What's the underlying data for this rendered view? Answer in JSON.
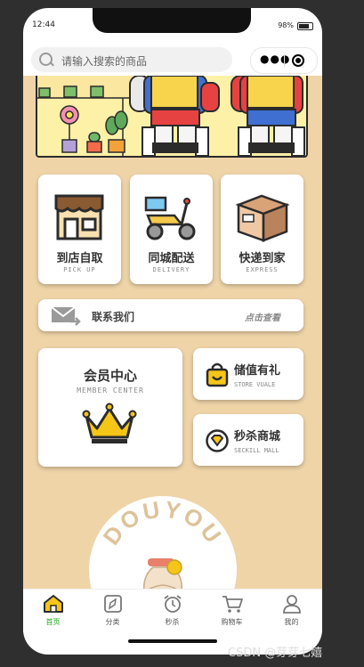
{
  "status": {
    "time": "12:44",
    "battery": "98%"
  },
  "search": {
    "placeholder": "请输入搜索的商品"
  },
  "services": [
    {
      "title": "到店自取",
      "subtitle": "PICK UP"
    },
    {
      "title": "同城配送",
      "subtitle": "DELIVERY"
    },
    {
      "title": "快递到家",
      "subtitle": "EXPRESS"
    }
  ],
  "contact": {
    "label": "联系我们",
    "action": "点击查看"
  },
  "member": {
    "title": "会员中心",
    "subtitle": "MEMBER CENTER"
  },
  "store_value": {
    "title": "储值有礼",
    "subtitle": "STORE VUALE"
  },
  "seckill": {
    "title": "秒杀商城",
    "subtitle": "SECKILL MALL"
  },
  "brand": {
    "text": "DOUYOU"
  },
  "tabbar": {
    "tabs": [
      {
        "label": "首页",
        "icon": "home-icon",
        "active": true
      },
      {
        "label": "分类",
        "icon": "category-icon"
      },
      {
        "label": "秒杀",
        "icon": "alarm-clock-icon"
      },
      {
        "label": "购物车",
        "icon": "cart-icon"
      },
      {
        "label": "我的",
        "icon": "user-icon"
      }
    ]
  },
  "colors": {
    "accent": "#1aad19",
    "background": "#efd4a8",
    "crown": "#f5c518"
  },
  "watermark": "CSDN @芽芽七嬉"
}
